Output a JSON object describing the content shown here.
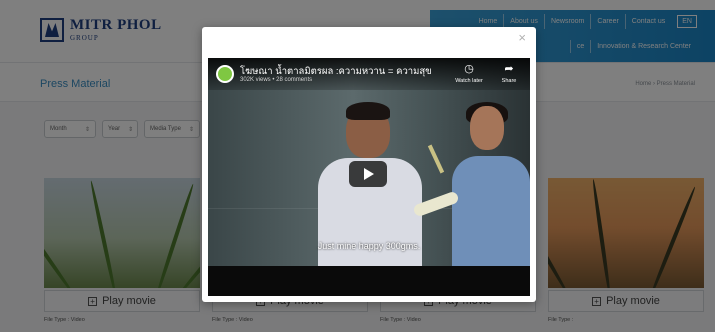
{
  "header": {
    "logo": {
      "name": "MITR PHOL",
      "sub": "GROUP"
    },
    "top_nav": [
      "Home",
      "About us",
      "Newsroom",
      "Career",
      "Contact us"
    ],
    "lang": "EN",
    "sub_nav": [
      "ce",
      "Innovation & Research Center"
    ]
  },
  "section": {
    "title": "Press Material",
    "breadcrumb": "Home › Press Material"
  },
  "filters": [
    {
      "label": "Month"
    },
    {
      "label": "Year"
    },
    {
      "label": "Media Type"
    }
  ],
  "cards": [
    {
      "button": "Play movie",
      "file_type": "File Type : Video"
    },
    {
      "button": "Play movie",
      "file_type": "File Type : Video"
    },
    {
      "button": "Play movie",
      "file_type": "File Type : Video"
    },
    {
      "button": "Play movie",
      "file_type": "File Type :"
    }
  ],
  "modal": {
    "close_glyph": "×",
    "video": {
      "title": "โฆษณา น้ำตาลมิตรผล :ความหวาน = ความสุข",
      "meta": "302K views • 28 comments",
      "watch_later": "Watch later",
      "share": "Share",
      "subtitle": "Just mine happy 300gms."
    }
  },
  "icons": {
    "watch_later": "clock-icon",
    "share": "share-arrow-icon",
    "play": "play-icon",
    "plus": "plus-square-icon"
  },
  "colors": {
    "brand_blue": "#1f3f80",
    "accent_blue": "#3a8fc4",
    "avatar_green": "#7fc742"
  }
}
